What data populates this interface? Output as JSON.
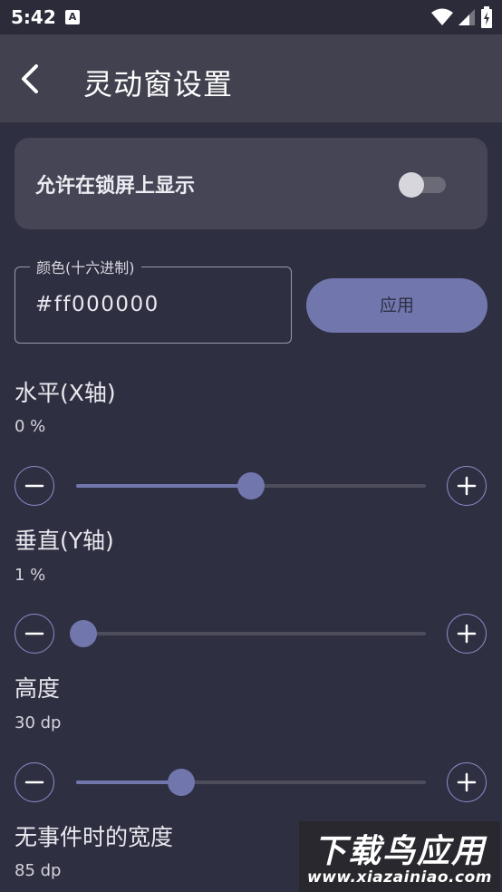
{
  "status_bar": {
    "time": "5:42",
    "notification_badge": "A",
    "icons": [
      "wifi-icon",
      "signal-icon",
      "battery-icon"
    ]
  },
  "app_bar": {
    "title": "灵动窗设置",
    "back_icon": "chevron-left-icon"
  },
  "lock_screen": {
    "label": "允许在锁屏上显示",
    "enabled": false
  },
  "color_input": {
    "label": "颜色(十六进制)",
    "value": "#ff000000"
  },
  "apply_button": {
    "label": "应用"
  },
  "settings": [
    {
      "title": "水平(X轴)",
      "value_text": "0 %",
      "fraction": 0.5
    },
    {
      "title": "垂直(Y轴)",
      "value_text": "1 %",
      "fraction": 0.02
    },
    {
      "title": "高度",
      "value_text": "30 dp",
      "fraction": 0.3
    },
    {
      "title": "无事件时的宽度",
      "value_text": "85 dp"
    }
  ],
  "watermark": {
    "text": "下载鸟应用",
    "url": "www.xiazainiao.com"
  },
  "colors": {
    "background": "#2f2f42",
    "app_bar": "#41414f",
    "card": "#454555",
    "accent": "#7177ad",
    "outline": "#8b8fc8"
  }
}
